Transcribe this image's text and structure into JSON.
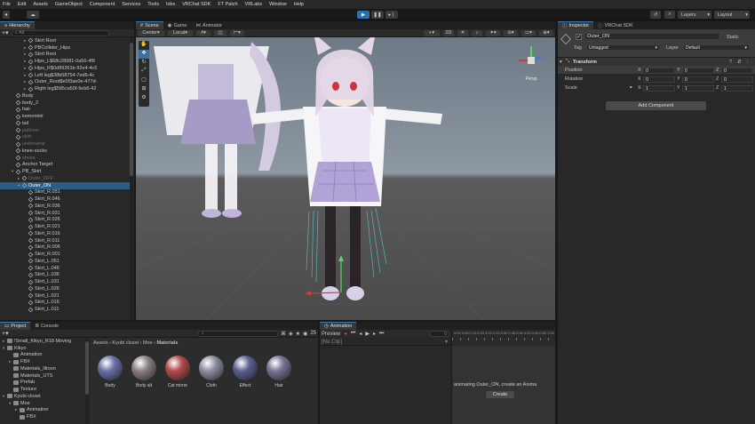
{
  "menu": [
    "File",
    "Edit",
    "Assets",
    "GameObject",
    "Component",
    "Services",
    "Tools",
    "lobs",
    "VRChat SDK",
    "FT Patch",
    "VRLabs",
    "Window",
    "Help"
  ],
  "toolbar": {
    "layers_label": "Layers",
    "layout_label": "Layout"
  },
  "hierarchy": {
    "tab_label": "Hierarchy",
    "search_placeholder": "All",
    "rows": [
      {
        "text": "Skirt Root",
        "depth": 5,
        "dim": false,
        "sel": false,
        "arrow": "▸",
        "icon": "cube"
      },
      {
        "text": "PBCollider_Hips",
        "depth": 5,
        "dim": false,
        "sel": false,
        "arrow": "▸",
        "icon": "cube"
      },
      {
        "text": "Skirt Root",
        "depth": 5,
        "dim": false,
        "sel": false,
        "arrow": "▸",
        "icon": "cube"
      },
      {
        "text": "Hips_L$68c28981-0a56-4f8",
        "depth": 5,
        "dim": false,
        "sel": false,
        "arrow": "▸",
        "icon": "cube"
      },
      {
        "text": "Hips_R$0d89261b-92e4-4c6",
        "depth": 5,
        "dim": false,
        "sel": false,
        "arrow": "▸",
        "icon": "cube"
      },
      {
        "text": "Left leg$38b58754-7ed6-4c",
        "depth": 5,
        "dim": false,
        "sel": false,
        "arrow": "▸",
        "icon": "cube"
      },
      {
        "text": "Outer_Root$e5f3ae0e-477d-",
        "depth": 5,
        "dim": false,
        "sel": false,
        "arrow": "▸",
        "icon": "cube"
      },
      {
        "text": "Right leg$585ca50f-9eb6-42",
        "depth": 5,
        "dim": false,
        "sel": false,
        "arrow": "▸",
        "icon": "cube"
      },
      {
        "text": "Body",
        "depth": 3,
        "dim": false,
        "sel": false,
        "arrow": "",
        "icon": "cube"
      },
      {
        "text": "body_2",
        "depth": 3,
        "dim": false,
        "sel": false,
        "arrow": "",
        "icon": "cube"
      },
      {
        "text": "hair",
        "depth": 3,
        "dim": false,
        "sel": false,
        "arrow": "",
        "icon": "cube"
      },
      {
        "text": "kemonimi",
        "depth": 3,
        "dim": false,
        "sel": false,
        "arrow": "",
        "icon": "cube"
      },
      {
        "text": "tail",
        "depth": 3,
        "dim": false,
        "sel": false,
        "arrow": "",
        "icon": "cube"
      },
      {
        "text": "pullover",
        "depth": 3,
        "dim": true,
        "sel": false,
        "arrow": "",
        "icon": "cube"
      },
      {
        "text": "skirt",
        "depth": 3,
        "dim": true,
        "sel": false,
        "arrow": "",
        "icon": "cube"
      },
      {
        "text": "underwear",
        "depth": 3,
        "dim": true,
        "sel": false,
        "arrow": "",
        "icon": "cube"
      },
      {
        "text": "knee-socks",
        "depth": 3,
        "dim": false,
        "sel": false,
        "arrow": "",
        "icon": "cube"
      },
      {
        "text": "shoes",
        "depth": 3,
        "dim": true,
        "sel": false,
        "arrow": "",
        "icon": "cube"
      },
      {
        "text": "Anchor Target",
        "depth": 3,
        "dim": false,
        "sel": false,
        "arrow": "",
        "icon": "cube"
      },
      {
        "text": "PB_Skirt",
        "depth": 3,
        "dim": false,
        "sel": false,
        "arrow": "▾",
        "icon": "cube"
      },
      {
        "text": "Outer_OFF",
        "depth": 4,
        "dim": true,
        "sel": false,
        "arrow": "▸",
        "icon": "cube"
      },
      {
        "text": "Outer_ON",
        "depth": 4,
        "dim": false,
        "sel": true,
        "arrow": "▾",
        "icon": "cube"
      },
      {
        "text": "Skirt_R.051",
        "depth": 5,
        "dim": false,
        "sel": false,
        "arrow": "",
        "icon": "cube"
      },
      {
        "text": "Skirt_R.046",
        "depth": 5,
        "dim": false,
        "sel": false,
        "arrow": "",
        "icon": "cube"
      },
      {
        "text": "Skirt_R.036",
        "depth": 5,
        "dim": false,
        "sel": false,
        "arrow": "",
        "icon": "cube"
      },
      {
        "text": "Skirt_R.031",
        "depth": 5,
        "dim": false,
        "sel": false,
        "arrow": "",
        "icon": "cube"
      },
      {
        "text": "Skirt_R.026",
        "depth": 5,
        "dim": false,
        "sel": false,
        "arrow": "",
        "icon": "cube"
      },
      {
        "text": "Skirt_R.021",
        "depth": 5,
        "dim": false,
        "sel": false,
        "arrow": "",
        "icon": "cube"
      },
      {
        "text": "Skirt_R.016",
        "depth": 5,
        "dim": false,
        "sel": false,
        "arrow": "",
        "icon": "cube"
      },
      {
        "text": "Skirt_R.011",
        "depth": 5,
        "dim": false,
        "sel": false,
        "arrow": "",
        "icon": "cube"
      },
      {
        "text": "Skirt_R.006",
        "depth": 5,
        "dim": false,
        "sel": false,
        "arrow": "",
        "icon": "cube"
      },
      {
        "text": "Skirt_R.001",
        "depth": 5,
        "dim": false,
        "sel": false,
        "arrow": "",
        "icon": "cube"
      },
      {
        "text": "Skirt_L.051",
        "depth": 5,
        "dim": false,
        "sel": false,
        "arrow": "",
        "icon": "cube"
      },
      {
        "text": "Skirt_L.046",
        "depth": 5,
        "dim": false,
        "sel": false,
        "arrow": "",
        "icon": "cube"
      },
      {
        "text": "Skirt_L.036",
        "depth": 5,
        "dim": false,
        "sel": false,
        "arrow": "",
        "icon": "cube"
      },
      {
        "text": "Skirt_L.031",
        "depth": 5,
        "dim": false,
        "sel": false,
        "arrow": "",
        "icon": "cube"
      },
      {
        "text": "Skirt_L.026",
        "depth": 5,
        "dim": false,
        "sel": false,
        "arrow": "",
        "icon": "cube"
      },
      {
        "text": "Skirt_L.021",
        "depth": 5,
        "dim": false,
        "sel": false,
        "arrow": "",
        "icon": "cube"
      },
      {
        "text": "Skirt_L.016",
        "depth": 5,
        "dim": false,
        "sel": false,
        "arrow": "",
        "icon": "cube"
      },
      {
        "text": "Skirt_L.011",
        "depth": 5,
        "dim": false,
        "sel": false,
        "arrow": "",
        "icon": "cube"
      }
    ]
  },
  "scene": {
    "tabs": [
      "Scene",
      "Game",
      "Animator"
    ],
    "pivot_label": "Center",
    "space_label": "Local",
    "mode_2d_label": "2D",
    "persp_label": "Persp"
  },
  "inspector": {
    "tabs": [
      "Inspector",
      "VRChat SDK"
    ],
    "object_name": "Outer_ON",
    "static_label": "Static",
    "tag_label": "Tag",
    "tag_value": "Untagged",
    "layer_label": "Layer",
    "layer_value": "Default",
    "transform_title": "Transform",
    "rows": [
      {
        "label": "Position",
        "x": "0",
        "y": "0",
        "z": "0"
      },
      {
        "label": "Rotation",
        "x": "0",
        "y": "0",
        "z": "0"
      },
      {
        "label": "Scale",
        "x": "1",
        "y": "1",
        "z": "1"
      }
    ],
    "add_component_label": "Add Component"
  },
  "project": {
    "tabs": [
      "Project",
      "Console"
    ],
    "count_label": "25",
    "tree": [
      {
        "text": "!Small_Kikyo_R18 Moving",
        "depth": 1,
        "arrow": "▸"
      },
      {
        "text": "Kikyo",
        "depth": 1,
        "arrow": "▾"
      },
      {
        "text": "Animation",
        "depth": 2,
        "arrow": ""
      },
      {
        "text": "FBX",
        "depth": 2,
        "arrow": "▸"
      },
      {
        "text": "Materials_liltoon",
        "depth": 2,
        "arrow": ""
      },
      {
        "text": "Materials_UTS",
        "depth": 2,
        "arrow": ""
      },
      {
        "text": "Prefab",
        "depth": 2,
        "arrow": ""
      },
      {
        "text": "Texture",
        "depth": 2,
        "arrow": ""
      },
      {
        "text": "Kyubi closet",
        "depth": 1,
        "arrow": "▾"
      },
      {
        "text": "Moe",
        "depth": 2,
        "arrow": "▾"
      },
      {
        "text": "Animation",
        "depth": 3,
        "arrow": "▸"
      },
      {
        "text": "FBX",
        "depth": 3,
        "arrow": ""
      }
    ],
    "breadcrumb": [
      "Assets",
      "Kyubi closet",
      "Moe",
      "Materials"
    ],
    "assets": [
      {
        "name": "Body",
        "color": "#6a6fa8"
      },
      {
        "name": "Body alt",
        "color": "#8a7f86"
      },
      {
        "name": "Cat mirror",
        "color": "#b44a4a"
      },
      {
        "name": "Cloth",
        "color": "#8c8ea0"
      },
      {
        "name": "Effect",
        "color": "#5a5f90"
      },
      {
        "name": "Hair",
        "color": "#7a7294"
      }
    ]
  },
  "animation": {
    "tab_label": "Animation",
    "preview_label": "Preview",
    "clip_label": "[No Clip]",
    "frame_value": "0",
    "message": "animating Outer_ON, create an Anima",
    "create_label": "Create",
    "ruler": [
      "0:00",
      "0:05",
      "0:10",
      "0:15",
      "0:20",
      "0:25",
      "0:30",
      "0:35",
      "0:40",
      "0:45",
      "0:50",
      "0:55",
      "1:00"
    ]
  }
}
